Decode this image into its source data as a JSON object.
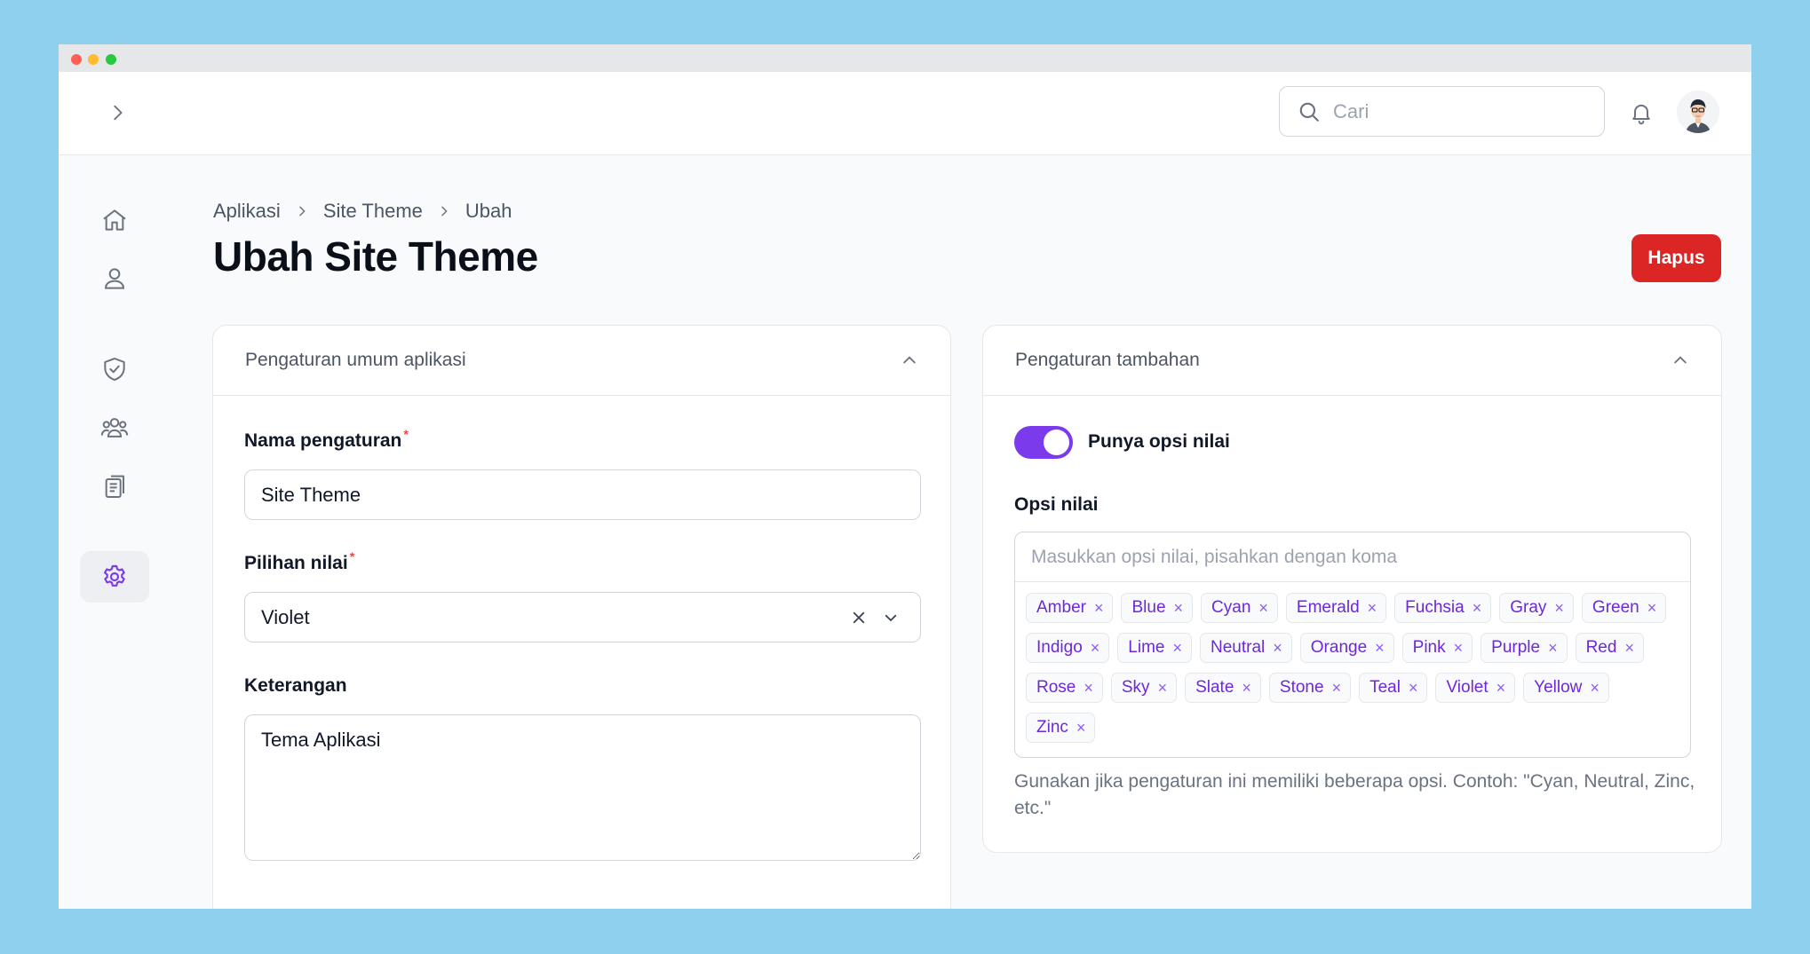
{
  "search": {
    "placeholder": "Cari"
  },
  "breadcrumb": {
    "items": [
      "Aplikasi",
      "Site Theme",
      "Ubah"
    ]
  },
  "page": {
    "title": "Ubah Site Theme",
    "delete_label": "Hapus"
  },
  "general_section": {
    "title": "Pengaturan umum aplikasi",
    "name_label": "Nama pengaturan",
    "name_value": "Site Theme",
    "value_label": "Pilihan nilai",
    "value_selected": "Violet",
    "desc_label": "Keterangan",
    "desc_value": "Tema Aplikasi",
    "required_mark": "*"
  },
  "extra_section": {
    "title": "Pengaturan tambahan",
    "toggle_label": "Punya opsi nilai",
    "toggle_on": true,
    "options_label": "Opsi nilai",
    "options_placeholder": "Masukkan opsi nilai, pisahkan dengan koma",
    "tags": [
      "Amber",
      "Blue",
      "Cyan",
      "Emerald",
      "Fuchsia",
      "Gray",
      "Green",
      "Indigo",
      "Lime",
      "Neutral",
      "Orange",
      "Pink",
      "Purple",
      "Red",
      "Rose",
      "Sky",
      "Slate",
      "Stone",
      "Teal",
      "Violet",
      "Yellow",
      "Zinc"
    ],
    "tag_remove_glyph": "×",
    "hint": "Gunakan jika pengaturan ini memiliki beberapa opsi. Contoh: \"Cyan, Neutral, Zinc, etc.\""
  },
  "colors": {
    "accent": "#7c3aed",
    "danger": "#dc2626",
    "background": "#8fd0ee"
  }
}
